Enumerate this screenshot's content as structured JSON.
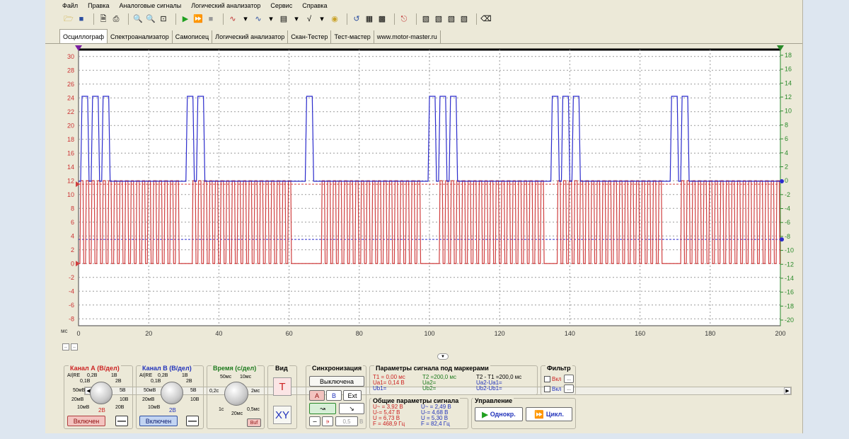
{
  "menu": [
    "Файл",
    "Правка",
    "Аналоговые сигналы",
    "Логический анализатор",
    "Сервис",
    "Справка"
  ],
  "tabs": [
    "Осциллограф",
    "Спектроанализатор",
    "Самописец",
    "Логический анализатор",
    "Скан-Тестер",
    "Тест-мастер",
    "www.motor-master.ru"
  ],
  "axes": {
    "left_ticks": [
      "30",
      "28",
      "26",
      "24",
      "22",
      "20",
      "18",
      "16",
      "14",
      "12",
      "10",
      "8",
      "6",
      "4",
      "2",
      "0",
      "-2",
      "-4",
      "-6",
      "-8"
    ],
    "right_ticks": [
      "18",
      "16",
      "14",
      "12",
      "10",
      "8",
      "6",
      "4",
      "2",
      "0",
      "-2",
      "-4",
      "-6",
      "-8",
      "-10",
      "-12",
      "-14",
      "-16",
      "-18",
      "-20"
    ],
    "x_ticks": [
      "0",
      "20",
      "40",
      "60",
      "80",
      "100",
      "120",
      "140",
      "160",
      "180",
      "200"
    ],
    "x_unit": "мс",
    "left_color": "#cc3333",
    "right_color": "#2a8a2a"
  },
  "chart_data": {
    "type": "line",
    "x_unit": "мс",
    "xlim": [
      0,
      200
    ],
    "series": [
      {
        "channel": "A",
        "color": "#d04040",
        "low": 0,
        "high": 12,
        "axis": "left"
      },
      {
        "channel": "B",
        "color": "#2b2bcc",
        "low": 0,
        "high": 12,
        "axis": "right",
        "burst_starts_ms": [
          0,
          30,
          64,
          99,
          134,
          168
        ],
        "pulses_per_burst": [
          3,
          2,
          1,
          3,
          3,
          2
        ]
      }
    ],
    "markers": {
      "T1": 0,
      "T2": 200
    }
  },
  "channel_a": {
    "title": "Канал А (В/дел)",
    "scales": [
      "0,2В",
      "1В",
      "0,1В",
      "2В",
      "50мВ",
      "5В",
      "20мВ",
      "10В",
      "10мВ",
      "20В"
    ],
    "current": "2В",
    "state": "Включен"
  },
  "channel_b": {
    "title": "Канал В (В/дел)",
    "scales": [
      "0,2В",
      "1В",
      "0,1В",
      "2В",
      "50мВ",
      "5В",
      "20мВ",
      "10В",
      "10мВ"
    ],
    "current": "2В",
    "state": "Включен"
  },
  "time": {
    "title": "Время (с/дел)",
    "scales": [
      "50мс",
      "10мс",
      "0,2с",
      "2мс",
      "1с",
      "0,5мс"
    ],
    "current": "20мс",
    "buf": "Buf"
  },
  "view": {
    "title": "Вид",
    "t": "T",
    "xy": "XY"
  },
  "sync": {
    "title": "Синхронизация",
    "mode": "Выключена",
    "sources": [
      "A",
      "B",
      "Ext"
    ],
    "level": "0,5",
    "unit": "В"
  },
  "markers_params": {
    "title": "Параметры сигнала под маркерами",
    "t1": "T1 = 0,00 мс",
    "ua1": "Ua1= 0,14 В",
    "ub1": "Ub1=",
    "t2": "T2 =200,0 мс",
    "ua2": "Ua2=",
    "ub2": "Ub2=",
    "dt": "T2 - T1 =200,0 мс",
    "dua": "Ua2-Ua1=",
    "dub": "Ub2-Ub1="
  },
  "general": {
    "title": "Общие параметры сигнала",
    "a": [
      "U~ = 3,92 В",
      "U-= 5,47 В",
      "U = 6,73 В",
      "F = 468,9 Гц"
    ],
    "b": [
      "U~ = 2,49 В",
      "U-= 4,68 В",
      "U = 5,30 В",
      "F = 82,4 Гц"
    ]
  },
  "filter": {
    "title": "Фильтр",
    "on": "Вкл"
  },
  "control": {
    "title": "Управление",
    "single": "Однокр.",
    "cycle": "Цикл."
  }
}
